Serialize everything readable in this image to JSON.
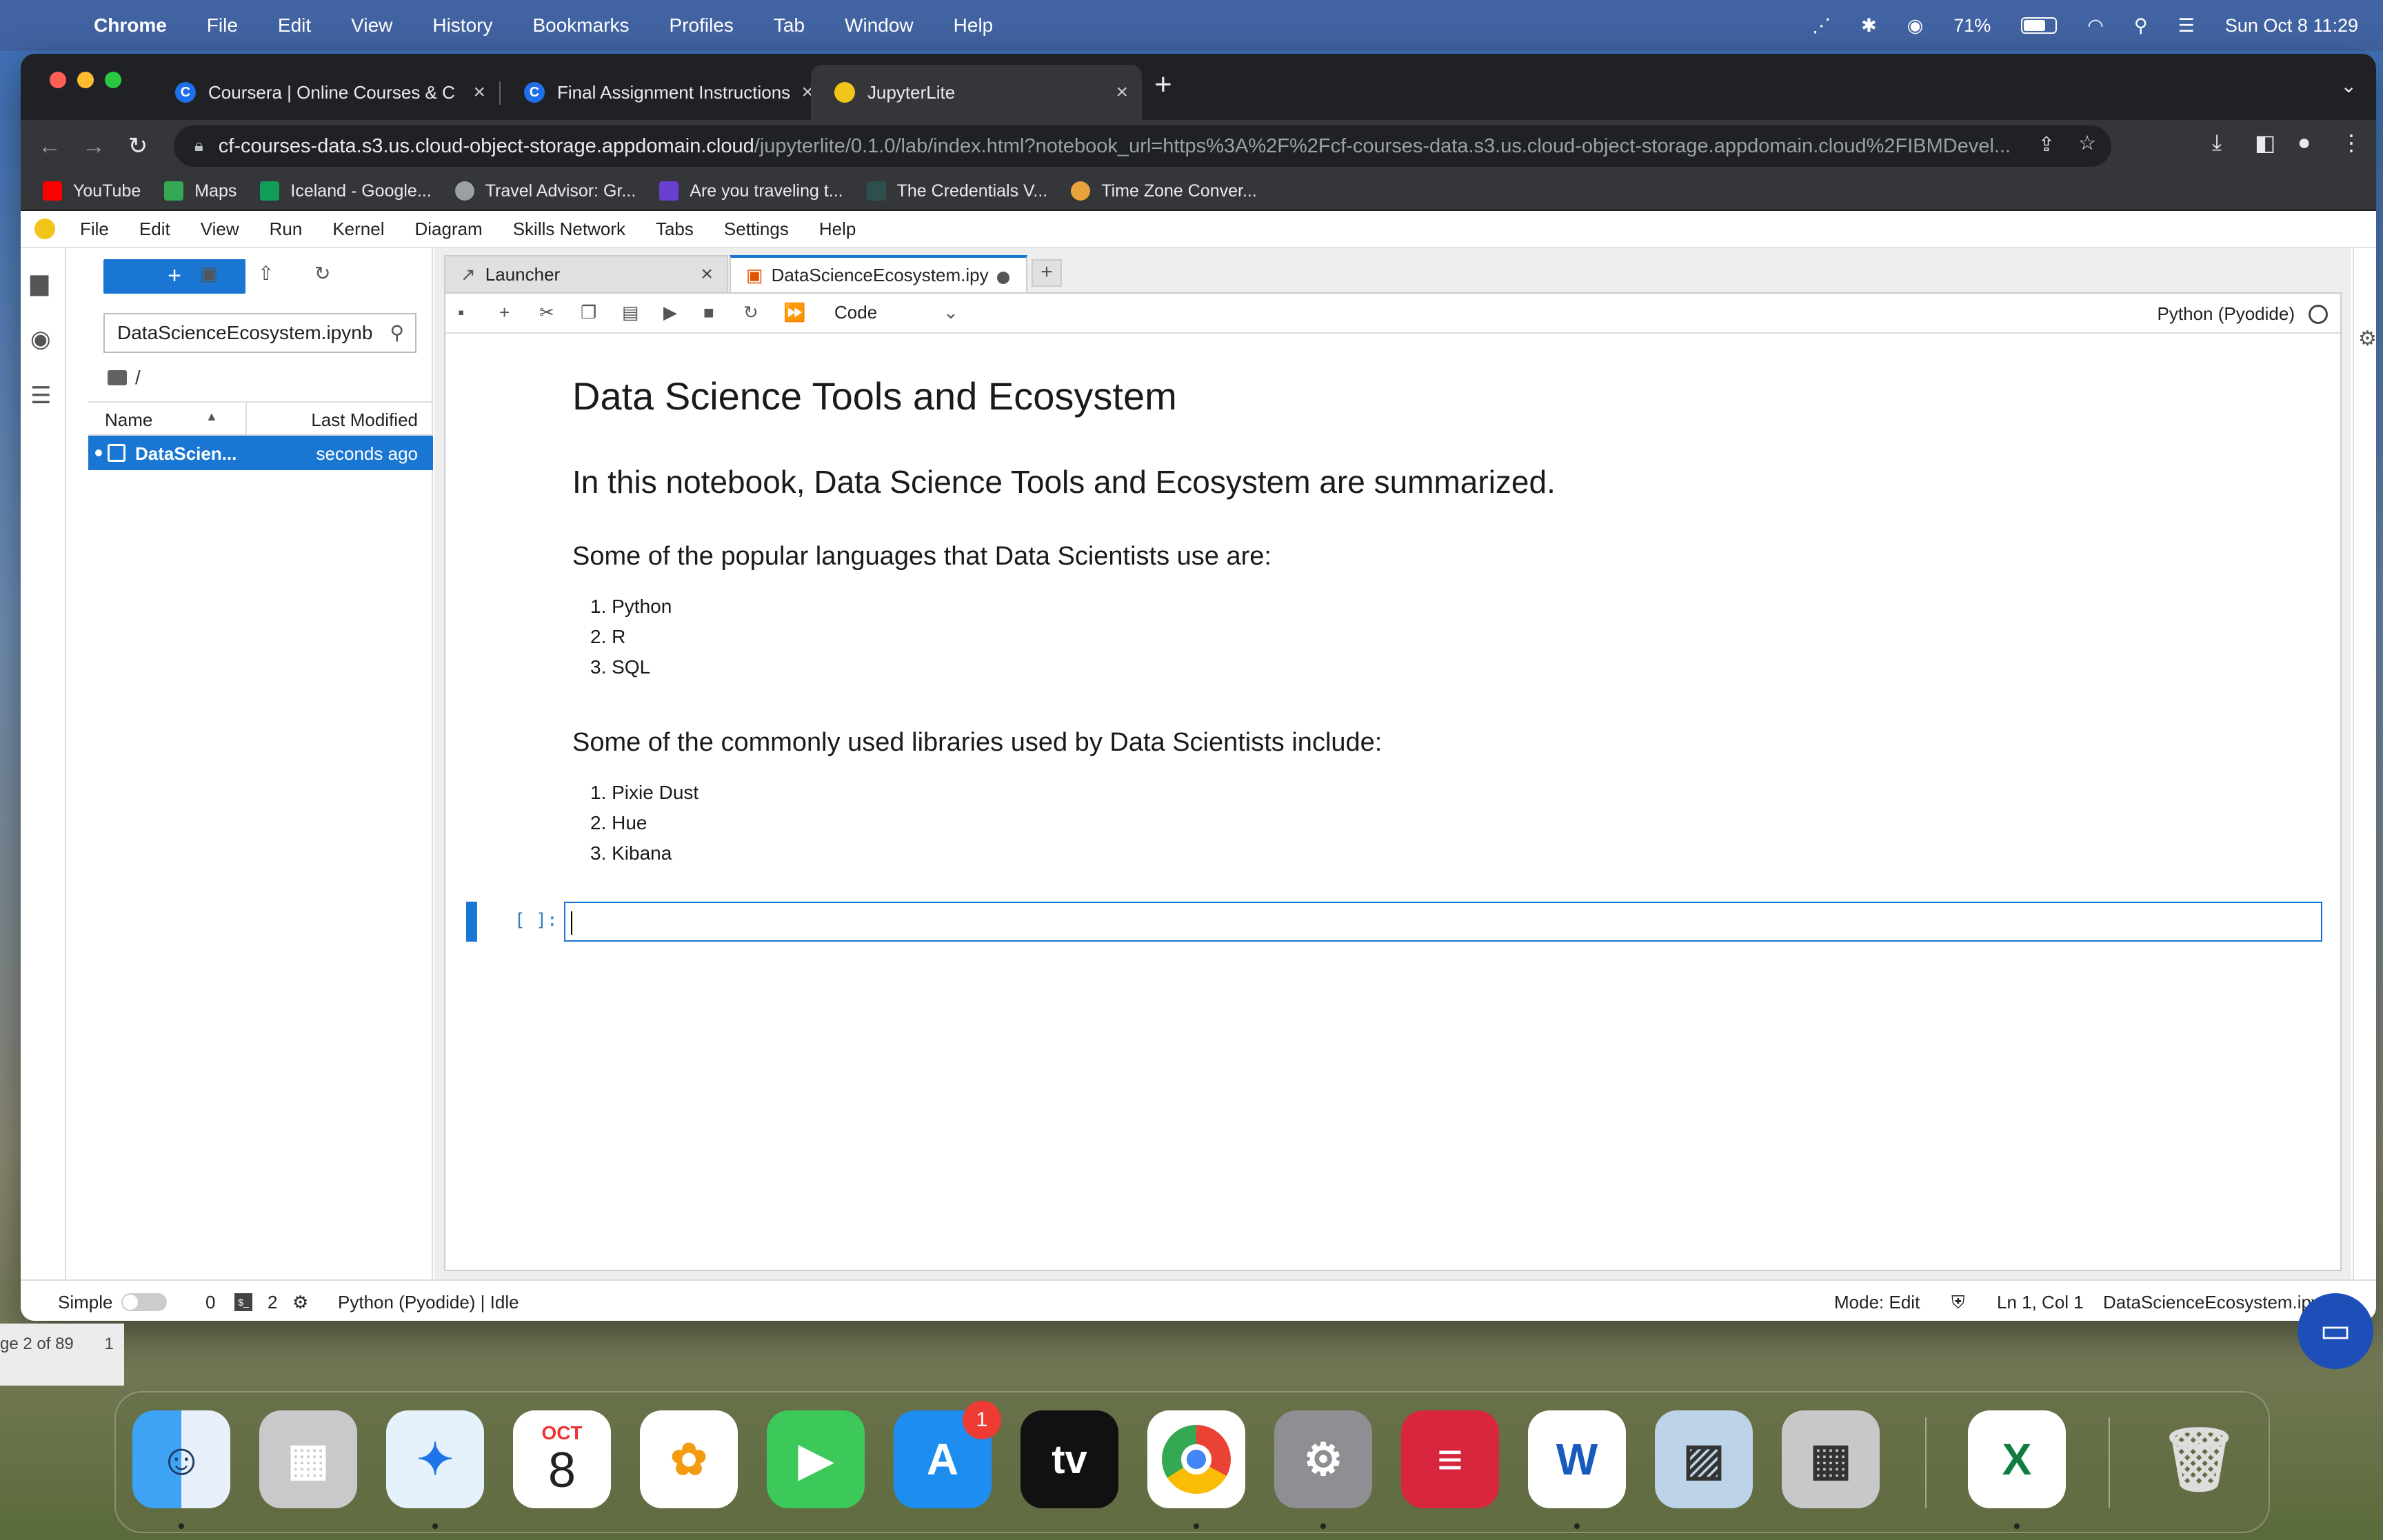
{
  "menubar": {
    "app": "Chrome",
    "items": [
      "File",
      "Edit",
      "View",
      "History",
      "Bookmarks",
      "Profiles",
      "Tab",
      "Window",
      "Help"
    ],
    "battery_percent": "71%",
    "battery_level": 0.71,
    "datetime": "Sun Oct 8  11:29"
  },
  "browser": {
    "tabs": [
      {
        "title": "Coursera | Online Courses & C",
        "favicon": "C"
      },
      {
        "title": "Final Assignment Instructions:",
        "favicon": "C"
      },
      {
        "title": "JupyterLite",
        "favicon": "J"
      }
    ],
    "new_tab": "+",
    "url_host": "cf-courses-data.s3.us.cloud-object-storage.appdomain.cloud",
    "url_path": "/jupyterlite/0.1.0/lab/index.html?notebook_url=https%3A%2F%2Fcf-courses-data.s3.us.cloud-object-storage.appdomain.cloud%2FIBMDevel...",
    "bookmarks": [
      {
        "label": "YouTube",
        "color": "#ff0000"
      },
      {
        "label": "Maps",
        "color": "#34a853"
      },
      {
        "label": "Iceland - Google...",
        "color": "#0f9d58"
      },
      {
        "label": "Travel Advisor: Gr...",
        "color": "#9aa0a6"
      },
      {
        "label": "Are you traveling t...",
        "color": "#6a3fd0"
      },
      {
        "label": "The Credentials V...",
        "color": "#2f4f4f"
      },
      {
        "label": "Time Zone Conver...",
        "color": "#e8a33d"
      }
    ]
  },
  "jupyter": {
    "menu": [
      "File",
      "Edit",
      "View",
      "Run",
      "Kernel",
      "Diagram",
      "Skills Network",
      "Tabs",
      "Settings",
      "Help"
    ],
    "filebrowser": {
      "new_label": "+",
      "filter_value": "DataScienceEcosystem.ipynb",
      "breadcrumb": "/",
      "col_name": "Name",
      "col_modified": "Last Modified",
      "files": [
        {
          "name": "DataScien...",
          "modified": "seconds ago"
        }
      ]
    },
    "doc_tabs": [
      {
        "title": "Launcher"
      },
      {
        "title": "DataScienceEcosystem.ipy"
      }
    ],
    "toolbar": {
      "cell_type": "Code",
      "kernel": "Python (Pyodide)"
    },
    "notebook": {
      "h1": "Data Science Tools and Ecosystem",
      "h2": "In this notebook, Data Science Tools and Ecosystem are summarized.",
      "h3_languages": "Some of the popular languages that Data Scientists use are:",
      "languages": [
        "1. Python",
        "2. R",
        "3. SQL"
      ],
      "h3_libraries": "Some of the commonly used libraries used by Data Scientists include:",
      "libraries": [
        "1. Pixie Dust",
        "2. Hue",
        "3. Kibana"
      ],
      "cell_prompt": "[ ]:"
    },
    "status": {
      "mode_label": "Simple",
      "terminals": "0",
      "kernels": "2",
      "kernel_status": "Python (Pyodide) | Idle",
      "mode": "Mode: Edit",
      "position": "Ln 1, Col 1",
      "filename": "DataScienceEcosystem.ipynb"
    }
  },
  "behind_window": {
    "page_indicator": "ge 2 of 89",
    "extra": "1"
  },
  "dock": {
    "calendar_month": "OCT",
    "calendar_day": "8",
    "appstore_badge": "1",
    "tv_label": "tv",
    "word_letter": "W",
    "excel_letter": "X"
  }
}
